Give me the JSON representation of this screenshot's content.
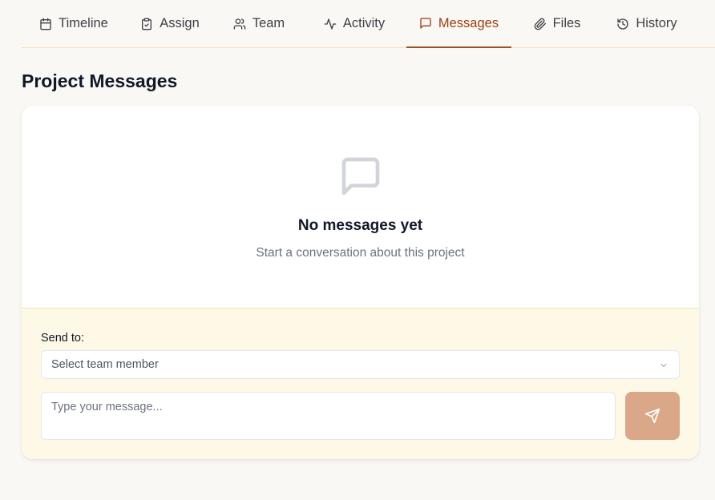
{
  "tabs": [
    {
      "label": "Timeline",
      "icon": "calendar-icon",
      "active": false
    },
    {
      "label": "Assign",
      "icon": "clipboard-check-icon",
      "active": false
    },
    {
      "label": "Team",
      "icon": "users-icon",
      "active": false
    },
    {
      "label": "Activity",
      "icon": "activity-icon",
      "active": false
    },
    {
      "label": "Messages",
      "icon": "message-square-icon",
      "active": true
    },
    {
      "label": "Files",
      "icon": "paperclip-icon",
      "active": false
    },
    {
      "label": "History",
      "icon": "history-icon",
      "active": false
    }
  ],
  "page": {
    "title": "Project Messages"
  },
  "empty_state": {
    "icon": "message-square-icon",
    "title": "No messages yet",
    "subtitle": "Start a conversation about this project"
  },
  "composer": {
    "send_to_label": "Send to:",
    "recipient_select": {
      "selected": "Select team member"
    },
    "message_placeholder": "Type your message...",
    "message_value": "",
    "send_icon": "send-icon"
  },
  "colors": {
    "accent": "#9a3f12",
    "active_underline": "#a0521d",
    "send_button": "#daa888",
    "composer_bg": "#fef8e6",
    "page_bg": "#faf8f4"
  }
}
